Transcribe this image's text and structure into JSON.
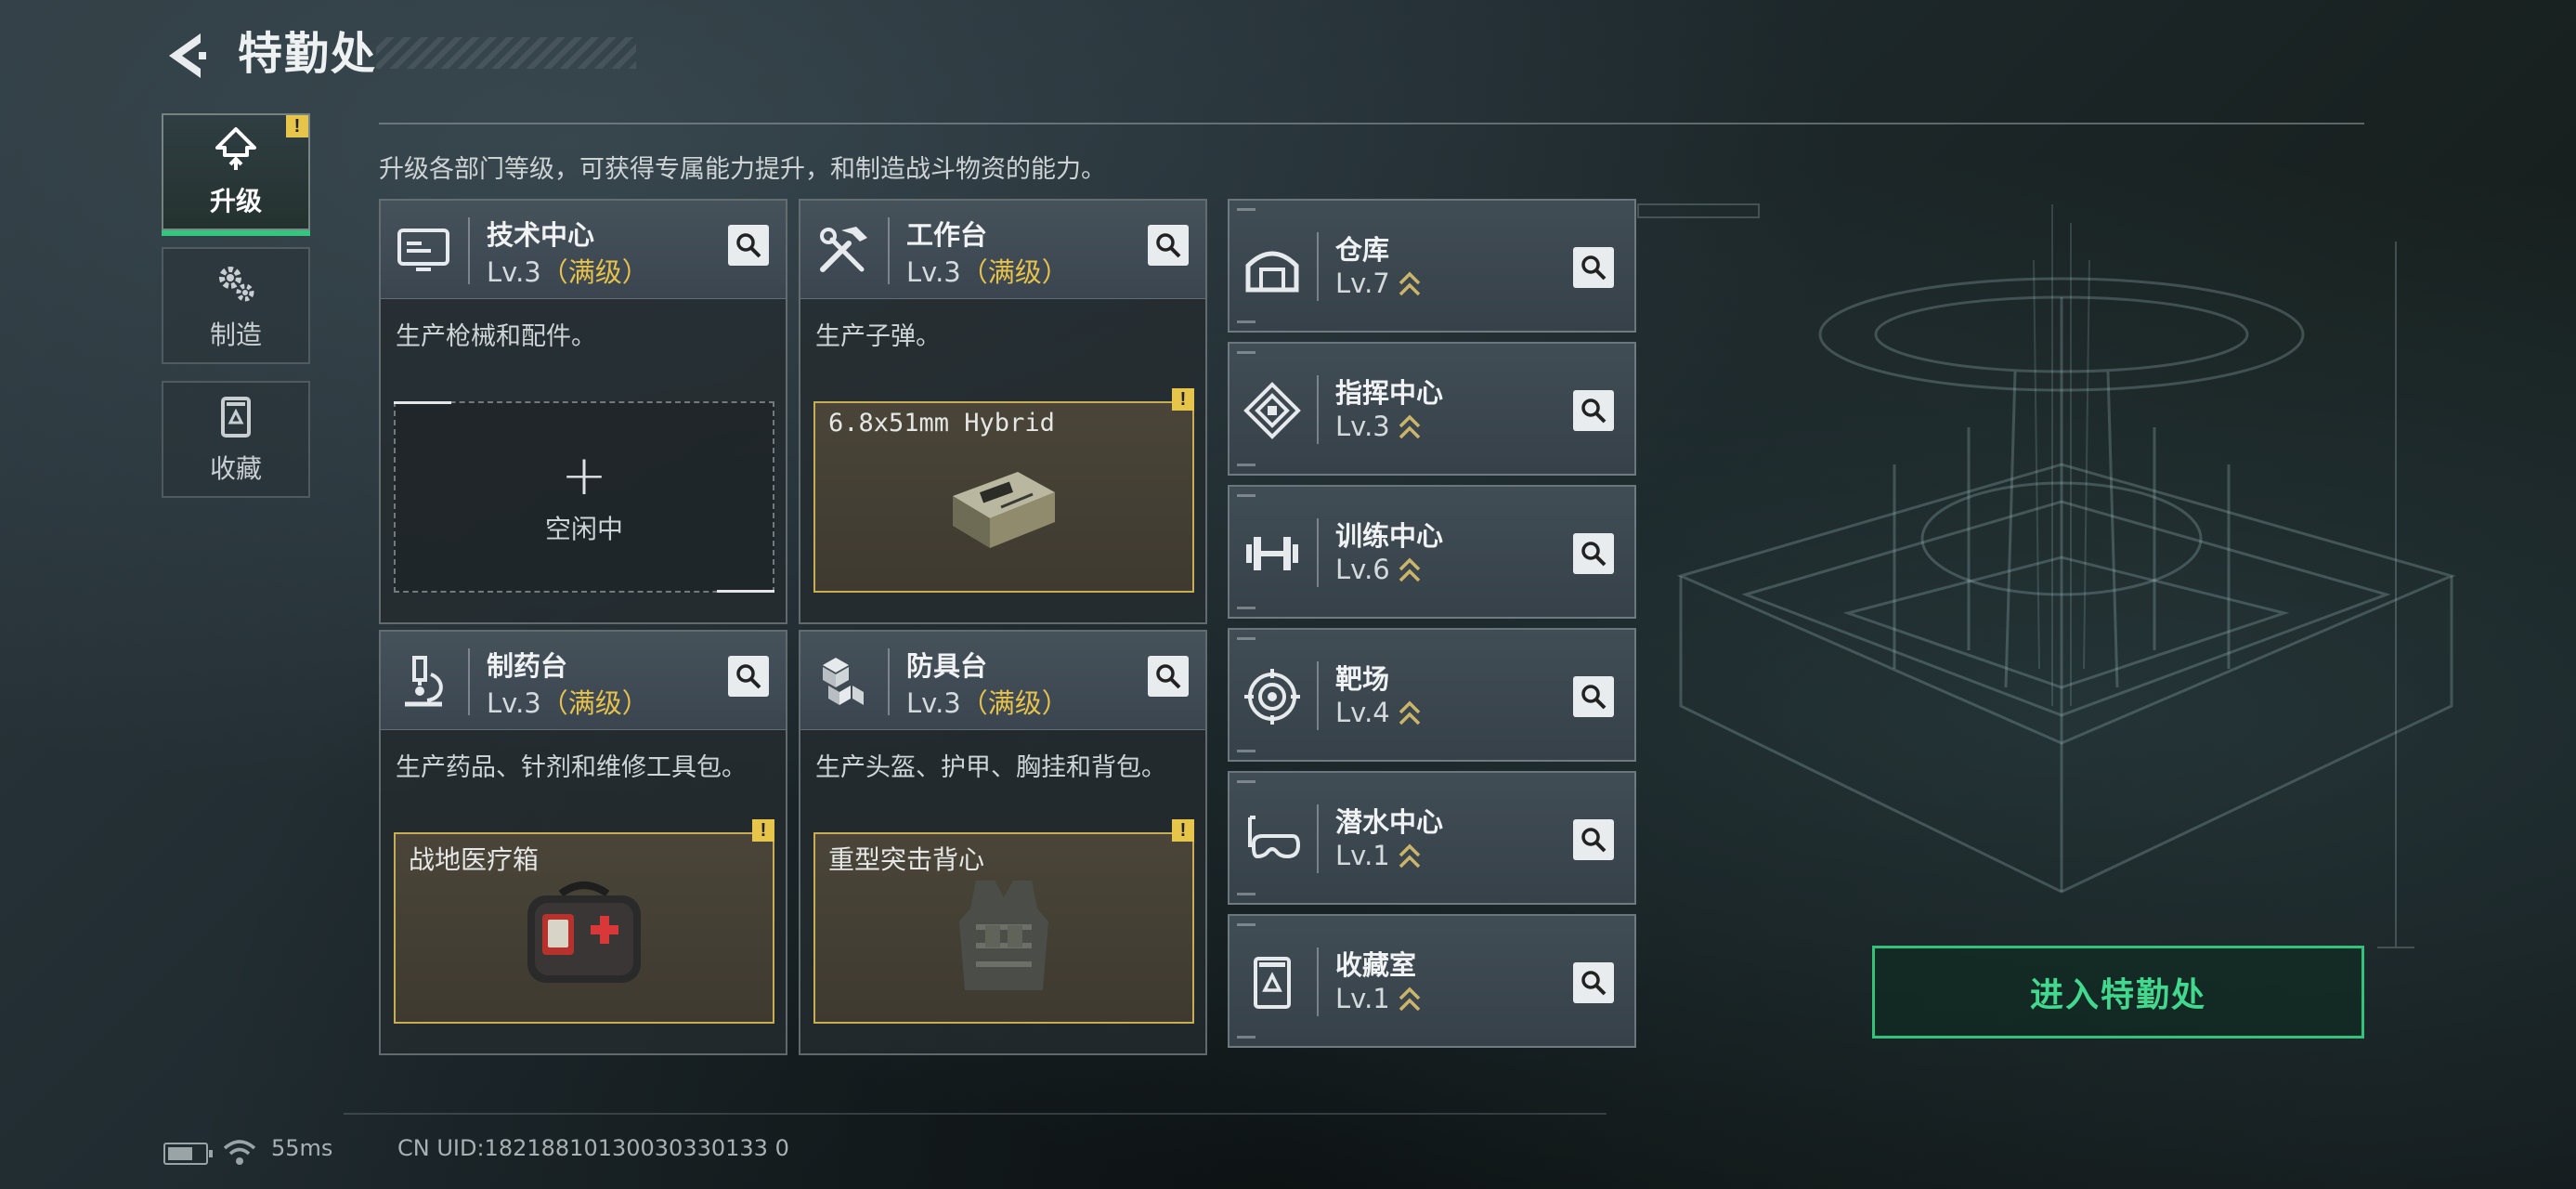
{
  "header": {
    "title": "特勤处"
  },
  "nav": [
    {
      "label": "升级",
      "icon": "upgrade-icon",
      "active": true,
      "alert": "!"
    },
    {
      "label": "制造",
      "icon": "gears-icon",
      "active": false
    },
    {
      "label": "收藏",
      "icon": "collection-icon",
      "active": false
    }
  ],
  "description": "升级各部门等级，可获得专属能力提升，和制造战斗物资的能力。",
  "facilities": [
    {
      "name": "技术中心",
      "level": "Lv.3",
      "max_label": "（满级）",
      "icon": "monitor-icon",
      "description": "生产枪械和配件。",
      "slot": {
        "state": "empty",
        "plus": "+",
        "status": "空闲中"
      }
    },
    {
      "name": "工作台",
      "level": "Lv.3",
      "max_label": "（满级）",
      "icon": "tools-icon",
      "description": "生产子弹。",
      "slot": {
        "state": "filled",
        "item": "6.8x51mm Hybrid",
        "alert": "!",
        "art": "ammo-box-icon"
      }
    },
    {
      "name": "制药台",
      "level": "Lv.3",
      "max_label": "（满级）",
      "icon": "microscope-icon",
      "description": "生产药品、针剂和维修工具包。",
      "slot": {
        "state": "filled",
        "item": "战地医疗箱",
        "alert": "!",
        "art": "medkit-icon"
      }
    },
    {
      "name": "防具台",
      "level": "Lv.3",
      "max_label": "（满级）",
      "icon": "cubes-icon",
      "description": "生产头盔、护甲、胸挂和背包。",
      "slot": {
        "state": "filled",
        "item": "重型突击背心",
        "alert": "!",
        "art": "vest-icon"
      }
    }
  ],
  "rooms": [
    {
      "name": "仓库",
      "level": "Lv.7",
      "icon": "warehouse-icon"
    },
    {
      "name": "指挥中心",
      "level": "Lv.3",
      "icon": "command-icon"
    },
    {
      "name": "训练中心",
      "level": "Lv.6",
      "icon": "dumbbell-icon"
    },
    {
      "name": "靶场",
      "level": "Lv.4",
      "icon": "target-icon"
    },
    {
      "name": "潜水中心",
      "level": "Lv.1",
      "icon": "diving-mask-icon"
    },
    {
      "name": "收藏室",
      "level": "Lv.1",
      "icon": "collection-room-icon"
    }
  ],
  "enter_button": "进入特勤处",
  "status": {
    "ping": "55ms",
    "uid": "CN UID:18218810130030330133 0"
  },
  "colors": {
    "accent_green": "#34c57f",
    "max_gold": "#e6c24c",
    "slot_border": "#c9ad52"
  }
}
